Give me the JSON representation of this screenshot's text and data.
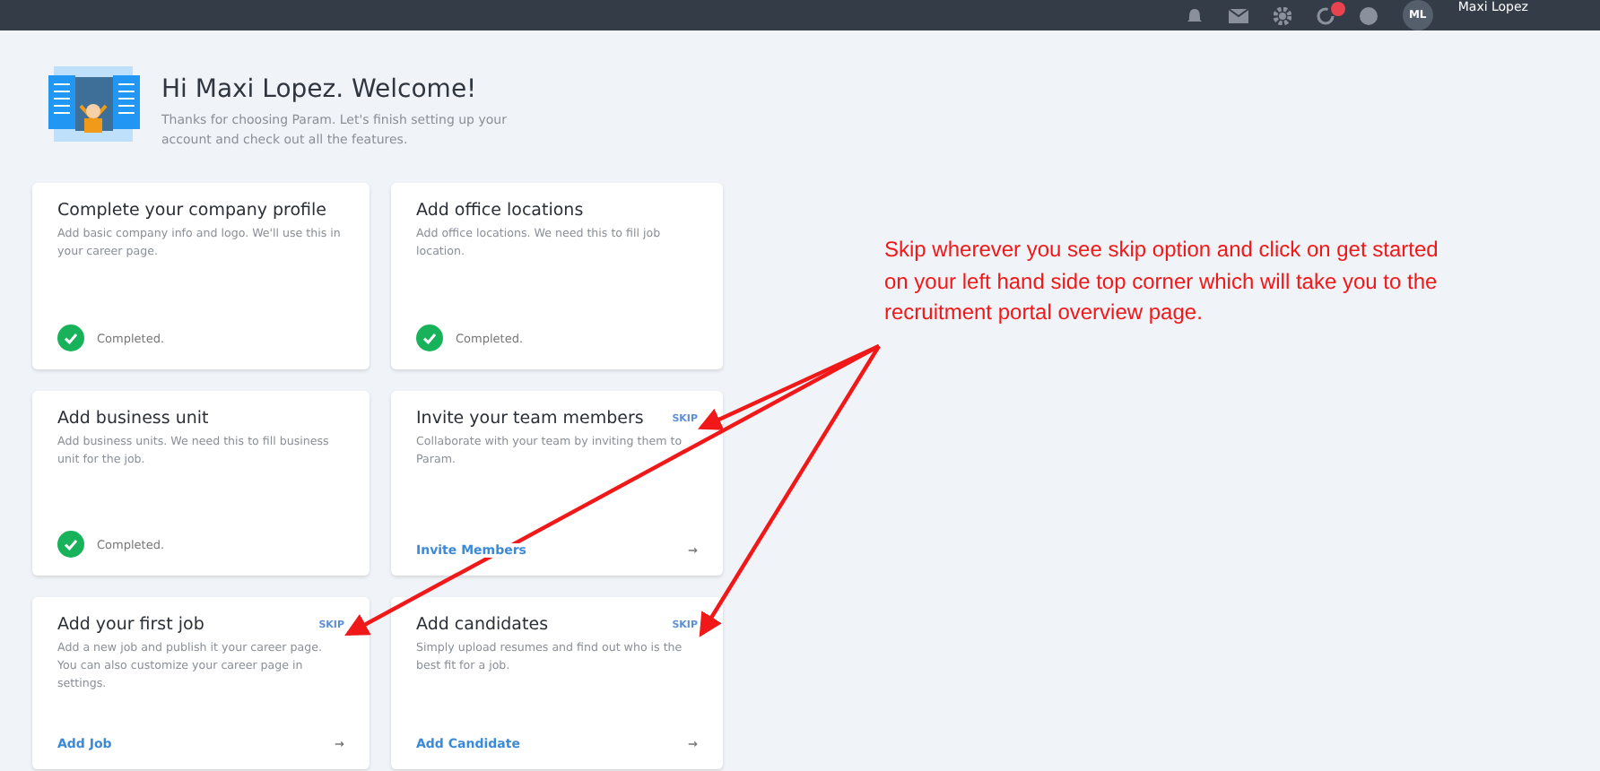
{
  "topbar": {
    "user_name": "Maxi Lopez",
    "avatar_initials": "ML",
    "notification_badge": true
  },
  "welcome": {
    "title": "Hi Maxi Lopez. Welcome!",
    "subtitle": "Thanks for choosing Param. Let's finish setting up your account and check out all the features."
  },
  "cards": [
    {
      "kind": "completed",
      "title": "Complete your company profile",
      "description": "Add basic company info and logo. We'll use this in your career page.",
      "status": "Completed."
    },
    {
      "kind": "completed",
      "title": "Add office locations",
      "description": "Add office locations. We need this to fill job location.",
      "status": "Completed."
    },
    {
      "kind": "completed",
      "title": "Add business unit",
      "description": "Add business units. We need this to fill business unit for the job.",
      "status": "Completed."
    },
    {
      "kind": "action",
      "title": "Invite your team members",
      "skip": "SKIP",
      "description": "Collaborate with your team by inviting them to Param.",
      "link": "Invite Members",
      "arrow_glyph": "→"
    },
    {
      "kind": "action",
      "title": "Add your first job",
      "skip": "SKIP",
      "description": "Add a new job and publish it your career page. You can also customize your career page in settings.",
      "link": "Add Job",
      "arrow_glyph": "→"
    },
    {
      "kind": "action",
      "title": "Add candidates",
      "skip": "SKIP",
      "description": "Simply upload resumes and find out who is the best fit for a job.",
      "link": "Add Candidate",
      "arrow_glyph": "→"
    }
  ],
  "annotation": {
    "lines": [
      "Skip wherever you see skip option and click on get started",
      "on your left hand side top corner which will take you to the",
      "recruitment portal overview page."
    ]
  }
}
